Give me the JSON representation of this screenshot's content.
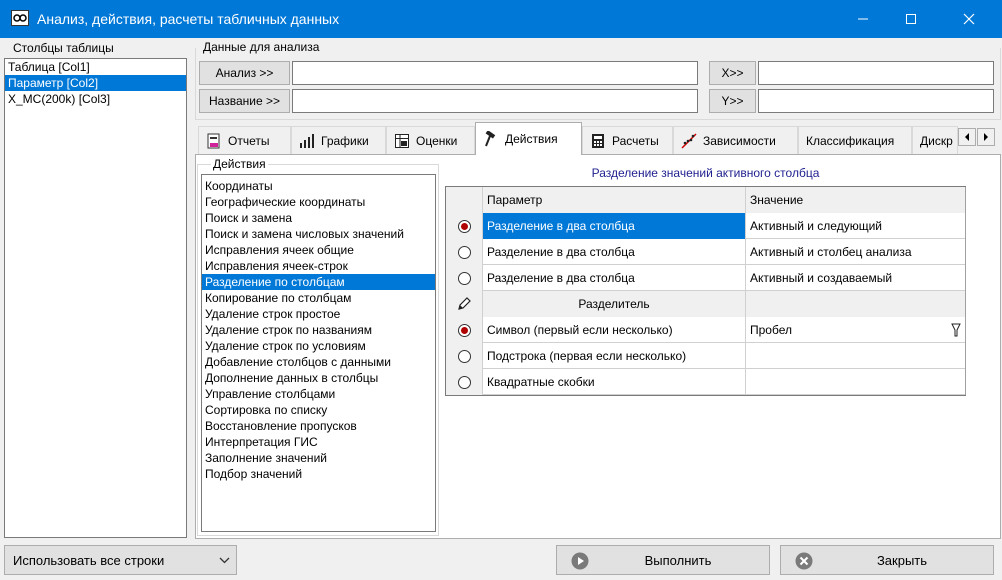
{
  "window": {
    "title": "Анализ, действия, расчеты табличных данных"
  },
  "columns_panel": {
    "title": "Столбцы таблицы",
    "items": [
      "Таблица [Col1]",
      "Параметр [Col2]",
      "X_MC(200k) [Col3]"
    ],
    "selected_index": 1
  },
  "data_panel": {
    "title": "Данные для анализа",
    "analysis_button": "Анализ >>",
    "name_button": "Название >>",
    "x_button": "X>>",
    "y_button": "Y>>",
    "analysis_value": "",
    "name_value": "",
    "x_value": "",
    "y_value": ""
  },
  "tabs": [
    {
      "label": "Отчеты",
      "icon": "report-icon"
    },
    {
      "label": "Графики",
      "icon": "bar-chart-icon"
    },
    {
      "label": "Оценки",
      "icon": "table-icon"
    },
    {
      "label": "Действия",
      "icon": "hammer-icon",
      "active": true
    },
    {
      "label": "Расчеты",
      "icon": "calculator-icon"
    },
    {
      "label": "Зависимости",
      "icon": "scatter-icon"
    },
    {
      "label": "Классификация",
      "icon": ""
    },
    {
      "label": "Дискр",
      "icon": ""
    }
  ],
  "actions_panel": {
    "title": "Действия",
    "items": [
      "Координаты",
      "Географические координаты",
      "Поиск и замена",
      "Поиск и замена числовых значений",
      "Исправления ячеек общие",
      "Исправления ячеек-строк",
      "Разделение по столбцам",
      "Копирование по столбцам",
      "Удаление строк простое",
      "Удаление строк по названиям",
      "Удаление строк по условиям",
      "Добавление столбцов с данными",
      "Дополнение данных в столбцы",
      "Управление столбцами",
      "Сортировка по списку",
      "Восстановление пропусков",
      "Интерпретация ГИС",
      "Заполнение значений",
      "Подбор значений"
    ],
    "selected_index": 6
  },
  "details": {
    "title": "Разделение значений активного столбца",
    "header_param": "Параметр",
    "header_value": "Значение",
    "rows": [
      {
        "param": "Разделение в два столбца",
        "value": "Активный и следующий",
        "checked": true
      },
      {
        "param": "Разделение в два столбца",
        "value": "Активный и столбец анализа",
        "checked": false
      },
      {
        "param": "Разделение в два столбца",
        "value": "Активный и создаваемый",
        "checked": false
      },
      {
        "param": "Разделитель",
        "value": "",
        "section": true
      },
      {
        "param": "Символ (первый если несколько)",
        "value": "Пробел",
        "checked": true,
        "dropdown": true
      },
      {
        "param": "Подстрока (первая если несколько)",
        "value": "",
        "checked": false
      },
      {
        "param": "Квадратные скобки",
        "value": "",
        "checked": false
      }
    ]
  },
  "footer": {
    "row_mode": "Использовать все строки",
    "run_button": "Выполнить",
    "close_button": "Закрыть"
  },
  "colors": {
    "accent": "#0078d7",
    "radio_dot": "#b00000"
  }
}
